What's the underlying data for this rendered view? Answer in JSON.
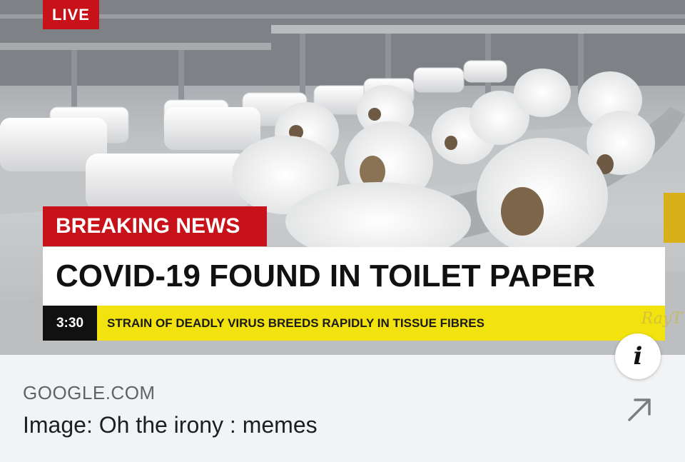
{
  "news_overlay": {
    "live_label": "LIVE",
    "breaking_label": "BREAKING NEWS",
    "headline": "COVID-19 FOUND IN TOILET PAPER",
    "clock": "3:30",
    "ticker": "STRAIN OF DEADLY VIRUS BREEDS RAPIDLY IN TISSUE FIBRES",
    "watermark": "RayT"
  },
  "link_card": {
    "domain": "GOOGLE.COM",
    "title": "Image: Oh the irony : memes"
  },
  "icons": {
    "info": "info-icon",
    "open_link": "external-arrow-icon"
  },
  "colors": {
    "breaking_red": "#c61218",
    "ticker_yellow": "#f2e30f",
    "card_background": "#f2f3f5"
  }
}
